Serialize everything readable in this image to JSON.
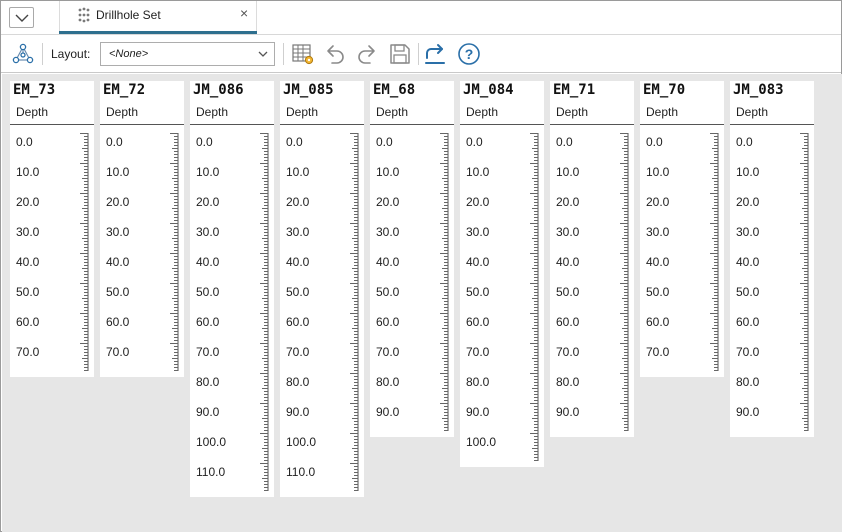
{
  "tab": {
    "label": "Drillhole Set",
    "icon": "drillhole-set-icon",
    "close_glyph": "×"
  },
  "toolbar": {
    "layout_label": "Layout:",
    "layout_value": "<None>",
    "icons": [
      "network-icon",
      "table-settings-icon",
      "undo-icon",
      "redo-icon",
      "save-icon",
      "export-icon",
      "help-icon"
    ],
    "help_glyph": "?"
  },
  "colors": {
    "accent": "#2e6f8e",
    "canvas_bg": "#e6e6e6",
    "icon_blue": "#2a6fa8"
  },
  "drillholes": [
    {
      "name": "EM_73",
      "subtitle": "Depth",
      "depths": [
        "0.0",
        "10.0",
        "20.0",
        "30.0",
        "40.0",
        "50.0",
        "60.0",
        "70.0"
      ]
    },
    {
      "name": "EM_72",
      "subtitle": "Depth",
      "depths": [
        "0.0",
        "10.0",
        "20.0",
        "30.0",
        "40.0",
        "50.0",
        "60.0",
        "70.0"
      ]
    },
    {
      "name": "JM_086",
      "subtitle": "Depth",
      "depths": [
        "0.0",
        "10.0",
        "20.0",
        "30.0",
        "40.0",
        "50.0",
        "60.0",
        "70.0",
        "80.0",
        "90.0",
        "100.0",
        "110.0"
      ]
    },
    {
      "name": "JM_085",
      "subtitle": "Depth",
      "depths": [
        "0.0",
        "10.0",
        "20.0",
        "30.0",
        "40.0",
        "50.0",
        "60.0",
        "70.0",
        "80.0",
        "90.0",
        "100.0",
        "110.0"
      ]
    },
    {
      "name": "EM_68",
      "subtitle": "Depth",
      "depths": [
        "0.0",
        "10.0",
        "20.0",
        "30.0",
        "40.0",
        "50.0",
        "60.0",
        "70.0",
        "80.0",
        "90.0"
      ]
    },
    {
      "name": "JM_084",
      "subtitle": "Depth",
      "depths": [
        "0.0",
        "10.0",
        "20.0",
        "30.0",
        "40.0",
        "50.0",
        "60.0",
        "70.0",
        "80.0",
        "90.0",
        "100.0"
      ]
    },
    {
      "name": "EM_71",
      "subtitle": "Depth",
      "depths": [
        "0.0",
        "10.0",
        "20.0",
        "30.0",
        "40.0",
        "50.0",
        "60.0",
        "70.0",
        "80.0",
        "90.0"
      ]
    },
    {
      "name": "EM_70",
      "subtitle": "Depth",
      "depths": [
        "0.0",
        "10.0",
        "20.0",
        "30.0",
        "40.0",
        "50.0",
        "60.0",
        "70.0"
      ]
    },
    {
      "name": "JM_083",
      "subtitle": "Depth",
      "depths": [
        "0.0",
        "10.0",
        "20.0",
        "30.0",
        "40.0",
        "50.0",
        "60.0",
        "70.0",
        "80.0",
        "90.0"
      ]
    }
  ]
}
